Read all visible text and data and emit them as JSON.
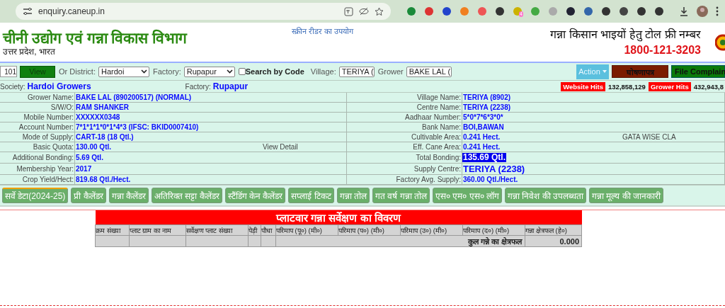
{
  "browser": {
    "url": "enquiry.caneup.in",
    "extension_badge": "4"
  },
  "header": {
    "title": "चीनी उद्योग एवं गन्ना विकास विभाग",
    "subtitle": "उत्तर प्रदेश, भारत",
    "screen_reader_link": "स्क्रीन रीडर का उपयोग",
    "tollfree_label": "गन्ना किसान भाइयों हेतु टोल फ्री नम्बर",
    "tollfree_number": "1800-121-3203"
  },
  "filter_bar": {
    "code_value": "101",
    "view_button": "View",
    "district_label": "Or  District:",
    "district": "Hardoi",
    "factory_label": "Factory:",
    "factory": "Rupapur",
    "search_by_code": {
      "label": "Search by Code",
      "checked": false
    },
    "village_label": "Village:",
    "village": "TERIYA (",
    "grower_label": "Grower",
    "grower": "BAKE LAL (",
    "action_button": "Action",
    "manifesto_button": "घोषणापत्र",
    "complaint_button": "File Complain"
  },
  "summary": {
    "society_label": "Society:",
    "society": "Hardoi Growers",
    "factory_label": "Factory:",
    "factory": "Rupapur",
    "website_hits_label": "Website Hits",
    "website_hits": "132,858,129",
    "grower_hits_label": "Grower Hits",
    "grower_hits": "432,943,8"
  },
  "info_rows": [
    {
      "left_label": "Grower Name:",
      "left_value": "BAKE LAL (890200517) (NORMAL)",
      "right_label": "Village Name:",
      "right_value": "TERIYA (8902)",
      "kind": "normal"
    },
    {
      "left_label": "S/W/O:",
      "left_value": "RAM SHANKER",
      "right_label": "Centre Name:",
      "right_value": "TERIYA (2238)",
      "kind": "normal"
    },
    {
      "left_label": "Mobile Number:",
      "left_value": "XXXXXX0348",
      "right_label": "Aadhaar Number:",
      "right_value": "5*0*7*6*3*0*",
      "kind": "normal"
    },
    {
      "left_label": "Account Number:",
      "left_value": "7*1*1*1*0*1*4*3 (IFSC: BKID0007410)",
      "right_label": "Bank Name:",
      "right_value": "BOI,BAWAN",
      "kind": "normal"
    },
    {
      "left_label": "Mode of Supply:",
      "left_value": "CART-18 (18 Qtl.)",
      "right_label": "Cultivable Area:",
      "right_value": "0.241 Hect.",
      "kind": "normal",
      "right_extra": "GATA WISE CLA"
    },
    {
      "left_label": "Basic Quota:",
      "left_value": "130.00 Qtl.",
      "left_extra": "View Detail",
      "right_label": "Eff. Cane Area:",
      "right_value": "0.241 Hect.",
      "kind": "normal"
    },
    {
      "left_label": "Additional Bonding:",
      "left_value": "5.69 Qtl.",
      "right_label": "Total Bonding:",
      "right_value": "135.69 Qtl.",
      "kind": "highlight"
    },
    {
      "left_label": "Membership Year:",
      "left_value": "2017",
      "right_label": "Supply Centre:",
      "right_value": "TERIYA (2238)",
      "kind": "large"
    },
    {
      "left_label": "Crop Yield/Hect:",
      "left_value": "819.68 Qtl./Hect.",
      "right_label": "Factory Avg. Supply:",
      "right_value": "360.00 Qtl./Hect.",
      "kind": "normal"
    }
  ],
  "tabs": [
    {
      "label": "सर्वे डेटा(2024-25)",
      "selected": true
    },
    {
      "label": "प्री कैलेंडर",
      "selected": false
    },
    {
      "label": "गन्ना कैलेंडर",
      "selected": false
    },
    {
      "label": "अतिरिक्त सट्टा कैलेंडर",
      "selected": false
    },
    {
      "label": "स्टैंडिंग केन कैलेंडर",
      "selected": false
    },
    {
      "label": "सप्लाई टिकट",
      "selected": false
    },
    {
      "label": "गन्ना तोल",
      "selected": false
    },
    {
      "label": "गत वर्ष गन्ना तोल",
      "selected": false
    },
    {
      "label": "एस० एम० एस० लॉग",
      "selected": false
    },
    {
      "label": "गन्ना निवेश की उपलब्धता",
      "selected": false
    },
    {
      "label": "गन्ना मूल्य की जानकारी",
      "selected": false
    }
  ],
  "survey": {
    "title": "प्लाटवार गन्ना सर्वेक्षण का विवरण",
    "columns": [
      "क्रम संख्या",
      "प्लाट ग्राम का नाम",
      "सर्वेक्षण प्लाट संख्या",
      "पेड़ी",
      "पौधा",
      "परिमाप (पू०) (मी०)",
      "परिमाप (प०) (मी०)",
      "परिमाप (उ०) (मी०)",
      "परिमाप (द०) (मी०)",
      "गन्ना क्षेत्रफल (हे०)"
    ],
    "total_label": "कुल गन्ने का क्षेत्रफल",
    "total_value": "0.000"
  }
}
